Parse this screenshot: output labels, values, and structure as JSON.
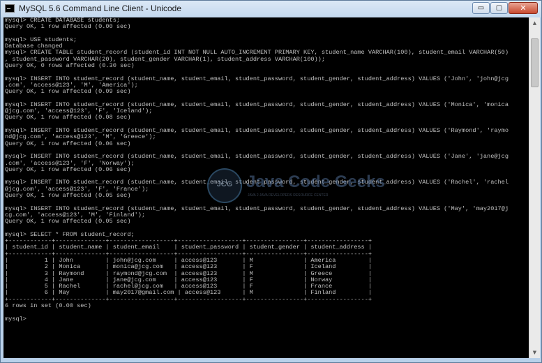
{
  "window": {
    "title": "MySQL 5.6 Command Line Client - Unicode",
    "icon": "mysql-console-icon"
  },
  "controls": {
    "minimize": "▭",
    "maximize": "▢",
    "close": "✕"
  },
  "watermark": {
    "logo": "JCG",
    "title": "Java Code Geeks",
    "subtitle": "JAVA 2 JAVA DEVELOPERS RESOURCE CENTER"
  },
  "console": {
    "lines": [
      "mysql> CREATE DATABASE students;",
      "Query OK, 1 row affected (0.00 sec)",
      "",
      "mysql> USE students;",
      "Database changed",
      "mysql> CREATE TABLE student_record (student_id INT NOT NULL AUTO_INCREMENT PRIMARY KEY, student_name VARCHAR(100), student_email VARCHAR(50)",
      ", student_password VARCHAR(20), student_gender VARCHAR(1), student_address VARCHAR(100));",
      "Query OK, 0 rows affected (0.30 sec)",
      "",
      "mysql> INSERT INTO student_record (student_name, student_email, student_password, student_gender, student_address) VALUES ('John', 'john@jcg",
      ".com', 'access@123', 'M', 'America');",
      "Query OK, 1 row affected (0.09 sec)",
      "",
      "mysql> INSERT INTO student_record (student_name, student_email, student_password, student_gender, student_address) VALUES ('Monica', 'monica",
      "@jcg.com', 'access@123', 'F', 'Iceland');",
      "Query OK, 1 row affected (0.08 sec)",
      "",
      "mysql> INSERT INTO student_record (student_name, student_email, student_password, student_gender, student_address) VALUES ('Raymond', 'raymo",
      "nd@jcg.com', 'access@123', 'M', 'Greece');",
      "Query OK, 1 row affected (0.06 sec)",
      "",
      "mysql> INSERT INTO student_record (student_name, student_email, student_password, student_gender, student_address) VALUES ('Jane', 'jane@jcg",
      ".com', 'access@123', 'F', 'Norway');",
      "Query OK, 1 row affected (0.06 sec)",
      "",
      "mysql> INSERT INTO student_record (student_name, student_email, student_password, student_gender, student_address) VALUES ('Rachel', 'rachel",
      "@jcg.com', 'access@123', 'F', 'France');",
      "Query OK, 1 row affected (0.05 sec)",
      "",
      "mysql> INSERT INTO student_record (student_name, student_email, student_password, student_gender, student_address) VALUES ('May', 'may2017@j",
      "cg.com', 'access@123', 'M', 'Finland');",
      "Query OK, 1 row affected (0.05 sec)",
      "",
      "mysql> SELECT * FROM student_record;",
      "+------------+--------------+------------------+------------------+----------------+-----------------+",
      "| student_id | student_name | student_email    | student_password | student_gender | student_address |",
      "+------------+--------------+------------------+------------------+----------------+-----------------+",
      "|          1 | John         | john@jcg.com     | access@123       | M              | America         |",
      "|          2 | Monica       | monica@jcg.com   | access@123       | F              | Iceland         |",
      "|          3 | Raymond      | raymond@jcg.com  | access@123       | M              | Greece          |",
      "|          4 | Jane         | jane@jcg.com     | access@123       | F              | Norway          |",
      "|          5 | Rachel       | rachel@jcg.com   | access@123       | F              | France          |",
      "|          6 | May          | may2017@gmail.com | access@123      | M              | Finland         |",
      "+------------+--------------+------------------+------------------+----------------+-----------------+",
      "6 rows in set (0.00 sec)",
      "",
      "mysql>"
    ]
  },
  "scrollbar": {
    "up": "▲",
    "down": "▼"
  }
}
